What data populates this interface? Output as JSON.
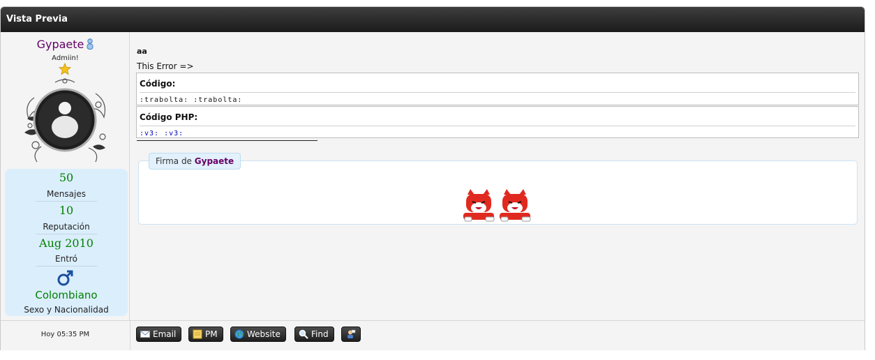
{
  "window": {
    "title": "Vista Previa"
  },
  "user": {
    "username": "Gypaete",
    "rank": "Admiin!",
    "stats": [
      {
        "value": "50",
        "label": "Mensajes"
      },
      {
        "value": "10",
        "label": "Reputación"
      },
      {
        "value": "Aug 2010",
        "label": "Entró"
      }
    ],
    "nationality": "Colombiano",
    "nationality_label": "Sexo y Nacionalidad",
    "icons": {
      "status": "user-icon",
      "star": "star-icon",
      "gender": "male-icon"
    }
  },
  "post": {
    "title": "aa",
    "text": "This Error =>",
    "code_blocks": [
      {
        "header": "Código:",
        "code": ":trabolta: :trabolta:",
        "color": "#111111"
      },
      {
        "header": "Código PHP:",
        "code": ":v3: :v3:",
        "color": "#0000bb"
      }
    ],
    "signature": {
      "prefix": "Firma de",
      "name": "Gypaete"
    }
  },
  "footer": {
    "date": "Hoy 05:35 PM",
    "buttons": [
      {
        "label": "Email",
        "icon": "email-icon"
      },
      {
        "label": "PM",
        "icon": "pm-icon"
      },
      {
        "label": "Website",
        "icon": "globe-icon"
      },
      {
        "label": "Find",
        "icon": "search-icon"
      },
      {
        "label": "",
        "icon": "contact-icon"
      }
    ]
  },
  "colors": {
    "username": "#660066",
    "stat_value": "#008000",
    "title_bar": "#1b1b1b",
    "stats_bg": "#dbeefc"
  }
}
